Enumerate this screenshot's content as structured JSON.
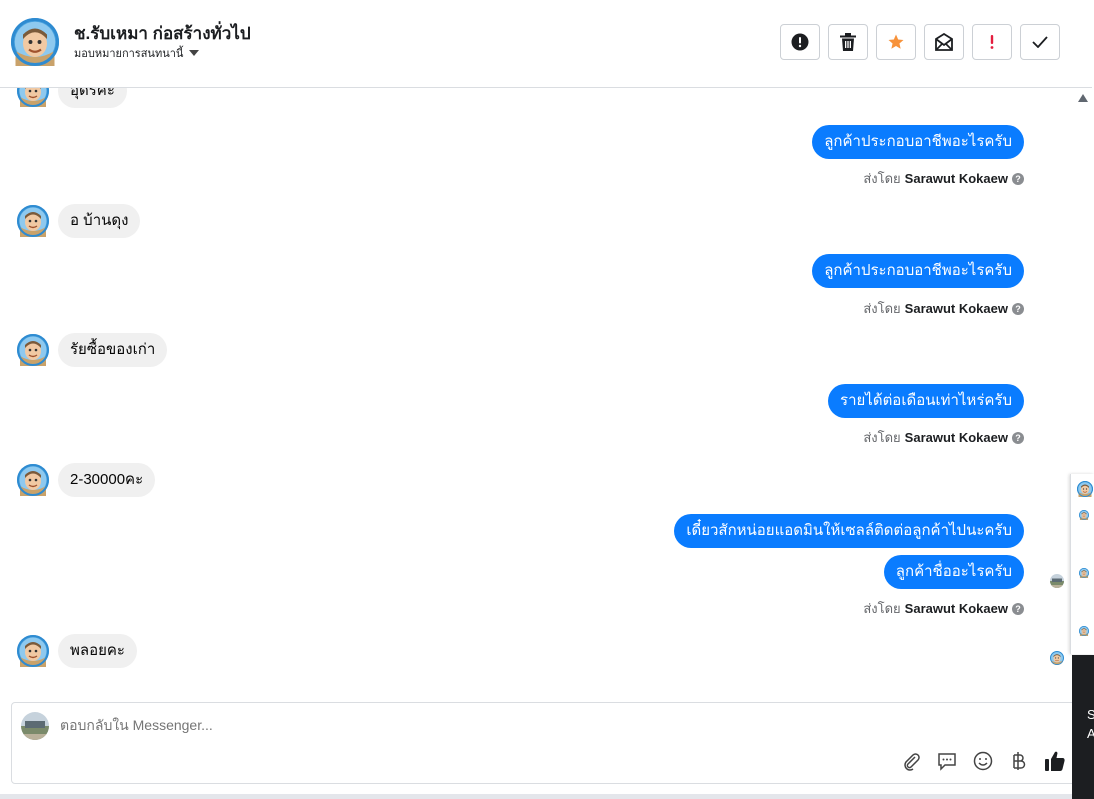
{
  "header": {
    "contact_name": "ช.รับเหมา ก่อสร้างทั่วไป",
    "assign_label": "มอบหมายการสนทนานี้",
    "toolbar": [
      {
        "name": "report-spam-button",
        "icon": "exclamation-circle-icon"
      },
      {
        "name": "delete-button",
        "icon": "trash-icon"
      },
      {
        "name": "star-button",
        "icon": "star-icon",
        "color": "#f7923a"
      },
      {
        "name": "mark-unread-button",
        "icon": "envelope-icon"
      },
      {
        "name": "follow-up-button",
        "icon": "exclamation-icon",
        "color": "#e41e3f"
      },
      {
        "name": "mark-done-button",
        "icon": "check-icon"
      }
    ]
  },
  "messages": {
    "in_0": "อุดรคะ",
    "out_1": "ลูกค้าประกอบอาชีพอะไรครับ",
    "in_2": "อ บ้านดุง",
    "out_3": "ลูกค้าประกอบอาชีพอะไรครับ",
    "in_4": "รัยซื้อของเก่า",
    "out_5": "รายได้ต่อเดือนเท่าไหร่ครับ",
    "in_6": "2-30000คะ",
    "out_7": "เดี๋ยวสักหน่อยแอดมินให้เซลล์ติดต่อลูกค้าไปนะครับ",
    "out_8": "ลูกค้าชื่ออะไรครับ",
    "in_9": "พลอยคะ"
  },
  "sent_by": {
    "prefix": "ส่งโดย",
    "agent": "Sarawut Kokaew",
    "help": "?"
  },
  "composer": {
    "placeholder": "ตอบกลับใน Messenger...",
    "icons": [
      "paperclip-icon",
      "saved-reply-icon",
      "emoji-icon",
      "baht-icon",
      "like-icon"
    ]
  },
  "edge": {
    "dark_text_1": "S",
    "dark_text_2": "A"
  },
  "colors": {
    "outgoing_bubble": "#0a7cff",
    "incoming_bubble": "#f0f0f0"
  }
}
